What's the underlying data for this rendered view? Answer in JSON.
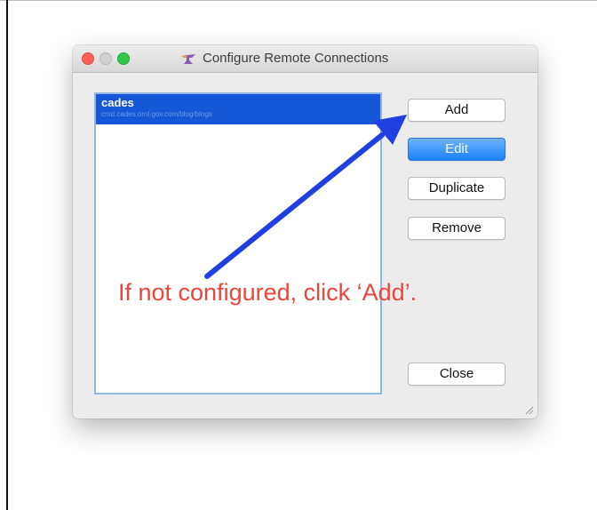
{
  "window": {
    "title": "Configure Remote Connections",
    "title_icon": "anvil-icon"
  },
  "list": {
    "items": [
      {
        "name": "cades",
        "subtitle": "cmd.cades.ornl.gov.com/blog/blogs"
      }
    ]
  },
  "buttons": {
    "add": "Add",
    "edit": "Edit",
    "duplicate": "Duplicate",
    "remove": "Remove",
    "close": "Close"
  },
  "annotation": {
    "text": "If not configured, click ‘Add’.",
    "text_color": "#e9473c",
    "arrow_color": "#1f3fe0"
  },
  "colors": {
    "selection": "#1557d6",
    "default_button": "#1a82fb"
  }
}
